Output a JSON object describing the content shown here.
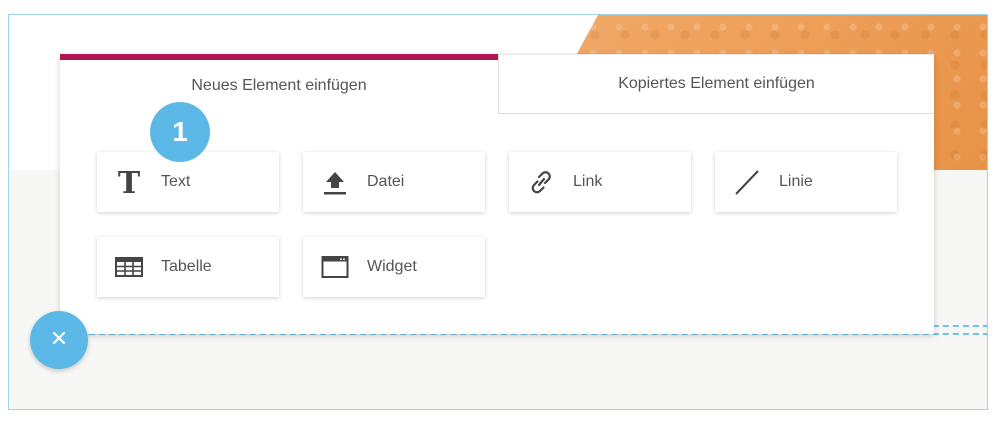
{
  "tabs": {
    "new_label": "Neues Element einfügen",
    "copy_label": "Kopiertes Element einfügen"
  },
  "badge": {
    "number": "1"
  },
  "elements": [
    {
      "label": "Text",
      "icon": "text-icon"
    },
    {
      "label": "Datei",
      "icon": "upload-icon"
    },
    {
      "label": "Link",
      "icon": "link-icon"
    },
    {
      "label": "Linie",
      "icon": "line-icon"
    },
    {
      "label": "Tabelle",
      "icon": "table-icon"
    },
    {
      "label": "Widget",
      "icon": "widget-icon"
    }
  ],
  "close_button": {
    "icon": "close-icon",
    "glyph": "×"
  },
  "colors": {
    "active_tab_accent": "#b31454",
    "badge_blue": "#5cb8e7",
    "dashed_line": "#6cc3ee",
    "frame_border": "#9fd4ef"
  }
}
